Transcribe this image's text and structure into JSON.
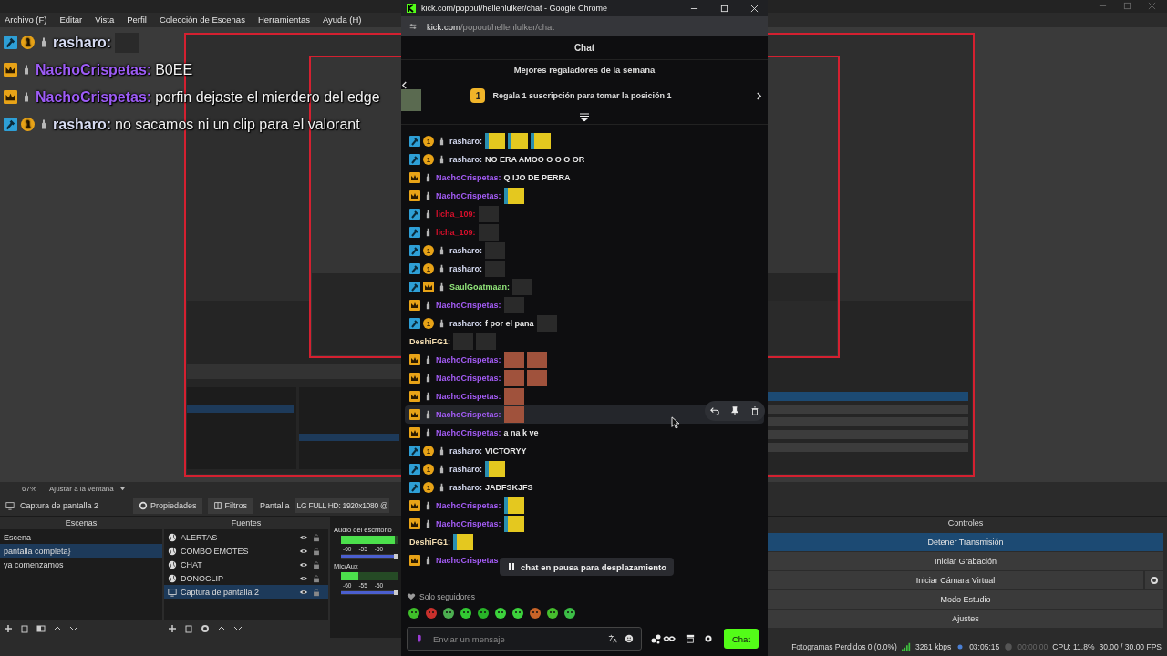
{
  "obs": {
    "menu": [
      "Archivo (F)",
      "Editar",
      "Vista",
      "Perfil",
      "Colección de Escenas",
      "Herramientas",
      "Ayuda (H)"
    ],
    "overlay_chat": [
      {
        "user": "rasharo:",
        "color": "#d6dbf2",
        "badges": [
          {
            "kind": "mod"
          },
          {
            "kind": "sub",
            "label": "1"
          },
          {
            "kind": "figure"
          }
        ],
        "emotes": [
          {
            "kind": "photo"
          }
        ]
      },
      {
        "user": "NachoCrispetas:",
        "color": "#9d5cf5",
        "badges": [
          {
            "kind": "vip"
          },
          {
            "kind": "figure"
          }
        ],
        "text": "B0EE"
      },
      {
        "user": "NachoCrispetas:",
        "color": "#9d5cf5",
        "badges": [
          {
            "kind": "vip"
          },
          {
            "kind": "figure"
          }
        ],
        "text": "porfin dejaste el mierdero del edge"
      },
      {
        "user": "rasharo:",
        "color": "#d6dbf2",
        "badges": [
          {
            "kind": "mod"
          },
          {
            "kind": "sub",
            "label": "1"
          },
          {
            "kind": "figure"
          }
        ],
        "text": "no sacamos ni un clip para el valorant"
      }
    ],
    "preview_zoom": "67%",
    "preview_fit": "Ajustar a la ventana",
    "source_bar": {
      "source": "Captura de pantalla 2",
      "properties": "Propiedades",
      "filters": "Filtros",
      "display_label": "Pantalla",
      "display_value": "LG FULL HD: 1920x1080 @"
    },
    "scenes": {
      "title": "Escenas",
      "items": [
        {
          "label": "Escena",
          "selected": false
        },
        {
          "label": "pantalla completa}",
          "selected": true
        },
        {
          "label": "ya comenzamos",
          "selected": false
        }
      ]
    },
    "sources": {
      "title": "Fuentes",
      "items": [
        {
          "label": "ALERTAS",
          "kind": "browser",
          "selected": false
        },
        {
          "label": "COMBO EMOTES",
          "kind": "browser",
          "selected": false
        },
        {
          "label": "CHAT",
          "kind": "browser",
          "selected": false
        },
        {
          "label": "DONOCLIP",
          "kind": "browser",
          "selected": false
        },
        {
          "label": "Captura de pantalla 2",
          "kind": "display",
          "selected": true
        }
      ]
    },
    "mixer": [
      {
        "name": "Audio del escritorio",
        "ticks": [
          "-60",
          "-55",
          "-50"
        ],
        "meter": {
          "level": 0.95
        },
        "fader": {
          "level": 1
        }
      },
      {
        "name": "Mic/Aux",
        "ticks": [
          "-60",
          "-55",
          "-50"
        ],
        "meter": {
          "level": 0.3
        },
        "fader": {
          "level": 1
        }
      }
    ],
    "controls": {
      "title": "Controles",
      "buttons": [
        {
          "label": "Detener Transmisión",
          "kind": "plain",
          "selected": true
        },
        {
          "label": "Iniciar Grabación",
          "kind": "plain",
          "selected": false
        },
        {
          "label": "Iniciar Cámara Virtual",
          "kind": "settings",
          "selected": false
        },
        {
          "label": "Modo Estudio",
          "kind": "plain",
          "selected": false
        },
        {
          "label": "Ajustes",
          "kind": "plain",
          "selected": false
        }
      ]
    },
    "status_bar": {
      "dropped": "Fotogramas Perdidos 0 (0.0%)",
      "bitrate": "3261 kbps",
      "stream_time": "03:05:15",
      "record_time": "00:00:00",
      "cpu": "CPU: 11.8%",
      "fps": "30.00 / 30.00 FPS"
    }
  },
  "chrome": {
    "title": "kick.com/popout/hellenlulker/chat - Google Chrome",
    "url_host": "kick.com",
    "url_path": "/popout/hellenlulker/chat",
    "chat": {
      "title": "Chat",
      "gifters_title": "Mejores regaladores de la semana",
      "gift_rank": "1",
      "gift_text": "Regala 1 suscripción para tomar la posición 1",
      "messages": [
        {
          "user": "rasharo:",
          "color": "#d6dbf2",
          "badges": [
            {
              "kind": "mod"
            },
            {
              "kind": "sub",
              "label": "1"
            },
            {
              "kind": "figure"
            }
          ],
          "emotes": [
            {
              "kind": "cartoon"
            },
            {
              "kind": "cartoon"
            },
            {
              "kind": "cartoon"
            }
          ],
          "highlighted": false
        },
        {
          "user": "rasharo:",
          "color": "#d6dbf2",
          "badges": [
            {
              "kind": "mod"
            },
            {
              "kind": "sub",
              "label": "1"
            },
            {
              "kind": "figure"
            }
          ],
          "text": "NO ERA AMOO O O O OR",
          "highlighted": false
        },
        {
          "user": "NachoCrispetas:",
          "color": "#a45cf6",
          "badges": [
            {
              "kind": "vip"
            },
            {
              "kind": "figure"
            }
          ],
          "text": "Q IJO DE PERRA",
          "highlighted": false
        },
        {
          "user": "NachoCrispetas:",
          "color": "#a45cf6",
          "badges": [
            {
              "kind": "vip"
            },
            {
              "kind": "figure"
            }
          ],
          "emotes": [
            {
              "kind": "cartoon"
            }
          ],
          "highlighted": false
        },
        {
          "user": "licha_109:",
          "color": "#d8102c",
          "badges": [
            {
              "kind": "mod"
            },
            {
              "kind": "figure"
            }
          ],
          "emotes": [
            {
              "kind": "photo"
            }
          ],
          "highlighted": false
        },
        {
          "user": "licha_109:",
          "color": "#d8102c",
          "badges": [
            {
              "kind": "mod"
            },
            {
              "kind": "figure"
            }
          ],
          "emotes": [
            {
              "kind": "photo"
            }
          ],
          "highlighted": false
        },
        {
          "user": "rasharo:",
          "color": "#d6dbf2",
          "badges": [
            {
              "kind": "mod"
            },
            {
              "kind": "sub",
              "label": "1"
            },
            {
              "kind": "figure"
            }
          ],
          "emotes": [
            {
              "kind": "photo"
            }
          ],
          "highlighted": false
        },
        {
          "user": "rasharo:",
          "color": "#d6dbf2",
          "badges": [
            {
              "kind": "mod"
            },
            {
              "kind": "sub",
              "label": "1"
            },
            {
              "kind": "figure"
            }
          ],
          "emotes": [
            {
              "kind": "photo"
            }
          ],
          "highlighted": false
        },
        {
          "user": "SaulGoatmaan:",
          "color": "#93e87c",
          "badges": [
            {
              "kind": "mod"
            },
            {
              "kind": "vip"
            },
            {
              "kind": "figure"
            }
          ],
          "emotes": [
            {
              "kind": "photo"
            }
          ],
          "highlighted": false
        },
        {
          "user": "NachoCrispetas:",
          "color": "#a45cf6",
          "badges": [
            {
              "kind": "vip"
            },
            {
              "kind": "figure"
            }
          ],
          "emotes": [
            {
              "kind": "photo"
            }
          ],
          "highlighted": false
        },
        {
          "user": "rasharo:",
          "color": "#d6dbf2",
          "badges": [
            {
              "kind": "mod"
            },
            {
              "kind": "sub",
              "label": "1"
            },
            {
              "kind": "figure"
            }
          ],
          "text": "f por el pana",
          "emotes": [
            {
              "kind": "photo"
            }
          ],
          "highlighted": false
        },
        {
          "user": "DeshiFG1:",
          "color": "#f2dcb0",
          "emotes": [
            {
              "kind": "photo"
            },
            {
              "kind": "photo"
            }
          ],
          "highlighted": false
        },
        {
          "user": "NachoCrispetas:",
          "color": "#a45cf6",
          "badges": [
            {
              "kind": "vip"
            },
            {
              "kind": "figure"
            }
          ],
          "emotes": [
            {
              "kind": "clip"
            },
            {
              "kind": "clip"
            }
          ],
          "highlighted": false
        },
        {
          "user": "NachoCrispetas:",
          "color": "#a45cf6",
          "badges": [
            {
              "kind": "vip"
            },
            {
              "kind": "figure"
            }
          ],
          "emotes": [
            {
              "kind": "clip"
            },
            {
              "kind": "clip"
            }
          ],
          "highlighted": false
        },
        {
          "user": "NachoCrispetas:",
          "color": "#a45cf6",
          "badges": [
            {
              "kind": "vip"
            },
            {
              "kind": "figure"
            }
          ],
          "emotes": [
            {
              "kind": "clip"
            }
          ],
          "highlighted": false
        },
        {
          "user": "NachoCrispetas:",
          "color": "#a45cf6",
          "badges": [
            {
              "kind": "vip"
            },
            {
              "kind": "figure"
            }
          ],
          "emotes": [
            {
              "kind": "clip"
            }
          ],
          "highlighted": true
        },
        {
          "user": "NachoCrispetas:",
          "color": "#a45cf6",
          "badges": [
            {
              "kind": "vip"
            },
            {
              "kind": "figure"
            }
          ],
          "text": "a na k ve",
          "highlighted": false
        },
        {
          "user": "rasharo:",
          "color": "#d6dbf2",
          "badges": [
            {
              "kind": "mod"
            },
            {
              "kind": "sub",
              "label": "1"
            },
            {
              "kind": "figure"
            }
          ],
          "text": "VICTORYY",
          "highlighted": false
        },
        {
          "user": "rasharo:",
          "color": "#d6dbf2",
          "badges": [
            {
              "kind": "mod"
            },
            {
              "kind": "sub",
              "label": "1"
            },
            {
              "kind": "figure"
            }
          ],
          "emotes": [
            {
              "kind": "cartoon"
            }
          ],
          "highlighted": false
        },
        {
          "user": "rasharo:",
          "color": "#d6dbf2",
          "badges": [
            {
              "kind": "mod"
            },
            {
              "kind": "sub",
              "label": "1"
            },
            {
              "kind": "figure"
            }
          ],
          "text": "JADFSKJFS",
          "highlighted": false
        },
        {
          "user": "NachoCrispetas:",
          "color": "#a45cf6",
          "badges": [
            {
              "kind": "vip"
            },
            {
              "kind": "figure"
            }
          ],
          "emotes": [
            {
              "kind": "cartoon"
            }
          ],
          "highlighted": false
        },
        {
          "user": "NachoCrispetas:",
          "color": "#a45cf6",
          "badges": [
            {
              "kind": "vip"
            },
            {
              "kind": "figure"
            }
          ],
          "emotes": [
            {
              "kind": "cartoon"
            }
          ],
          "highlighted": false
        },
        {
          "user": "DeshiFG1:",
          "color": "#f2dcb0",
          "emotes": [
            {
              "kind": "cartoon"
            }
          ],
          "highlighted": false
        },
        {
          "user": "NachoCrispetas",
          "color": "#a45cf6",
          "badges": [
            {
              "kind": "vip"
            },
            {
              "kind": "figure"
            }
          ],
          "highlighted": false
        }
      ],
      "paused_notice": "chat en pausa para desplazamiento",
      "mode": "Solo seguidores",
      "placeholder": "Enviar un mensaje",
      "send": "Chat"
    }
  }
}
